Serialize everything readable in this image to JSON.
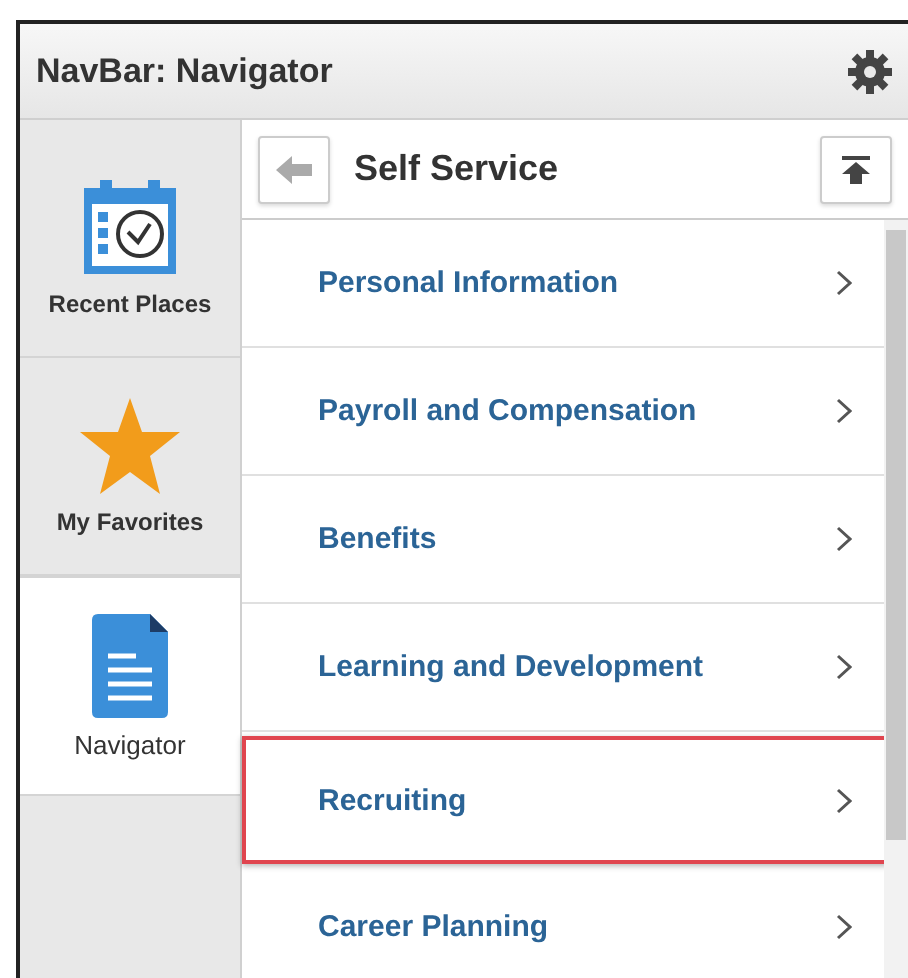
{
  "window": {
    "title": "NavBar: Navigator"
  },
  "sidebar": {
    "items": [
      {
        "label": "Recent Places",
        "kind": "calendar",
        "selected": false
      },
      {
        "label": "My Favorites",
        "kind": "star",
        "selected": false
      },
      {
        "label": "Navigator",
        "kind": "document",
        "selected": true
      }
    ]
  },
  "panel": {
    "title": "Self Service",
    "items": [
      {
        "label": "Personal Information",
        "highlighted": false
      },
      {
        "label": "Payroll and Compensation",
        "highlighted": false
      },
      {
        "label": "Benefits",
        "highlighted": false
      },
      {
        "label": "Learning and Development",
        "highlighted": false
      },
      {
        "label": "Recruiting",
        "highlighted": true
      },
      {
        "label": "Career Planning",
        "highlighted": false
      }
    ]
  }
}
